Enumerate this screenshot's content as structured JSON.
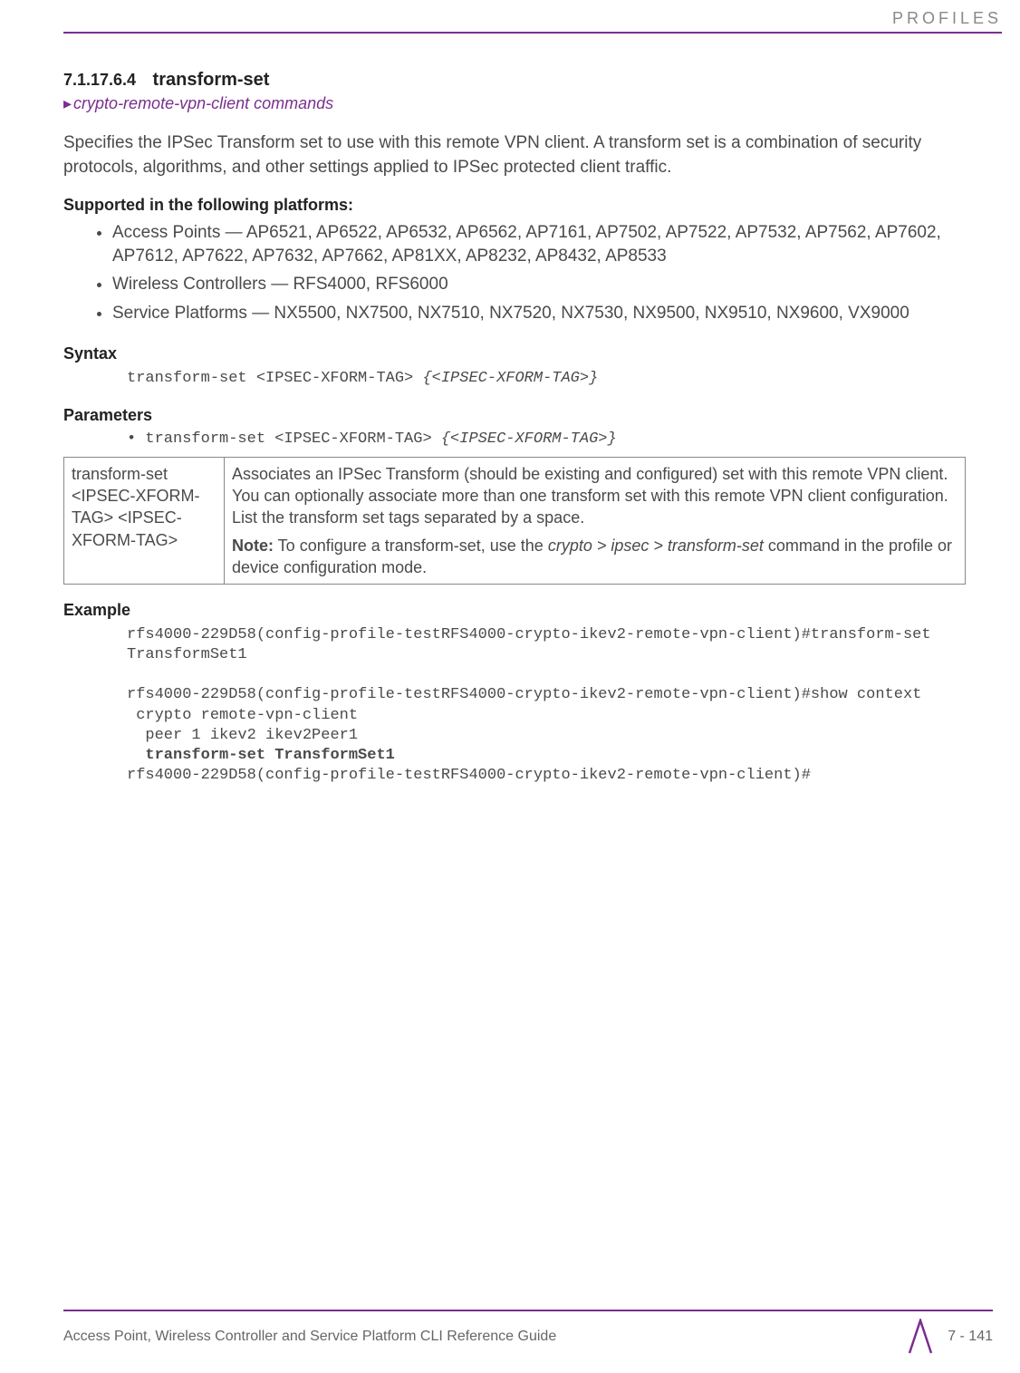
{
  "header": {
    "running": "PROFILES"
  },
  "section": {
    "number": "7.1.17.6.4",
    "title": "transform-set",
    "breadcrumb": "crypto-remote-vpn-client commands"
  },
  "intro": "Specifies the IPSec Transform set to use with this remote VPN client. A transform set is a combination of security protocols, algorithms, and other settings applied to IPSec protected client traffic.",
  "supported": {
    "heading": "Supported in the following platforms:",
    "items": [
      "Access Points — AP6521, AP6522, AP6532, AP6562, AP7161, AP7502, AP7522, AP7532, AP7562, AP7602, AP7612, AP7622, AP7632, AP7662, AP81XX, AP8232, AP8432, AP8533",
      "Wireless Controllers — RFS4000, RFS6000",
      "Service Platforms — NX5500, NX7500, NX7510, NX7520, NX7530, NX9500, NX9510, NX9600, VX9000"
    ]
  },
  "syntax": {
    "heading": "Syntax",
    "cmd_plain": "transform-set <IPSEC-XFORM-TAG> ",
    "cmd_italic": "{<IPSEC-XFORM-TAG>}"
  },
  "parameters": {
    "heading": "Parameters",
    "bullet_plain": "• transform-set <IPSEC-XFORM-TAG> ",
    "bullet_italic": "{<IPSEC-XFORM-TAG>}",
    "table": {
      "left": "transform-set <IPSEC-XFORM-TAG> <IPSEC-XFORM-TAG>",
      "right_desc": "Associates an IPSec Transform (should be existing and configured) set with this remote VPN client. You can optionally associate more than one transform set with this remote VPN client configuration. List the transform set tags separated by a space.",
      "note_label": "Note:",
      "note_prefix": " To configure a transform-set, use the ",
      "note_cmd": "crypto > ipsec > transform-set",
      "note_suffix": " command in the profile or device configuration mode."
    }
  },
  "example": {
    "heading": "Example",
    "lines": [
      "rfs4000-229D58(config-profile-testRFS4000-crypto-ikev2-remote-vpn-client)#transform-set TransformSet1",
      "",
      "rfs4000-229D58(config-profile-testRFS4000-crypto-ikev2-remote-vpn-client)#show context",
      " crypto remote-vpn-client",
      "  peer 1 ikev2 ikev2Peer1"
    ],
    "bold_line": "  transform-set TransformSet1",
    "tail": "rfs4000-229D58(config-profile-testRFS4000-crypto-ikev2-remote-vpn-client)#"
  },
  "footer": {
    "left": "Access Point, Wireless Controller and Service Platform CLI Reference Guide",
    "right": "7 - 141"
  }
}
